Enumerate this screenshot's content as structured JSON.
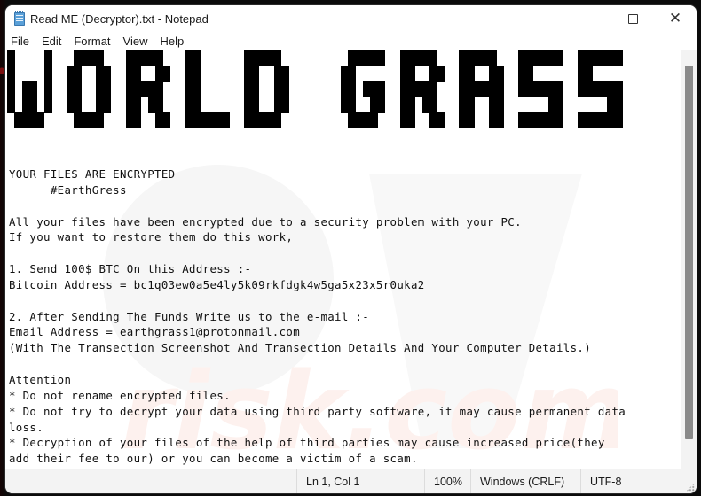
{
  "window": {
    "title": "Read ME (Decryptor).txt - Notepad",
    "app_icon": "notepad-icon",
    "controls": {
      "minimize": "minimize-icon",
      "maximize": "maximize-icon",
      "close": "close-icon"
    }
  },
  "menubar": {
    "items": [
      {
        "label": "File"
      },
      {
        "label": "Edit"
      },
      {
        "label": "Format"
      },
      {
        "label": "View"
      },
      {
        "label": "Help"
      }
    ]
  },
  "document": {
    "banner": "WORLD GRASS",
    "lines": [
      "YOUR FILES ARE ENCRYPTED",
      "      #EarthGress",
      "",
      "All your files have been encrypted due to a security problem with your PC.",
      "If you want to restore them do this work,",
      "",
      "1. Send 100$ BTC On this Address :-",
      "Bitcoin Address = bc1q03ew0a5e4ly5k09rkfdgk4w5ga5x23x5r0uka2",
      "",
      "2. After Sending The Funds Write us to the e-mail :-",
      "Email Address = earthgrass1@protonmail.com",
      "(With The Transection Screenshot And Transection Details And Your Computer Details.)",
      "",
      "Attention",
      "* Do not rename encrypted files.",
      "* Do not try to decrypt your data using third party software, it may cause permanent data",
      "loss.",
      "* Decryption of your files of the help of third parties may cause increased price(they",
      "add their fee to our) or you can become a victim of a scam."
    ]
  },
  "statusbar": {
    "position": "Ln 1, Col 1",
    "zoom": "100%",
    "line_ending": "Windows (CRLF)",
    "encoding": "UTF-8"
  },
  "colors": {
    "text": "#111111",
    "window_bg": "#ffffff",
    "statusbar_bg": "#f3f3f3",
    "scroll_thumb": "#8a8a8a"
  }
}
